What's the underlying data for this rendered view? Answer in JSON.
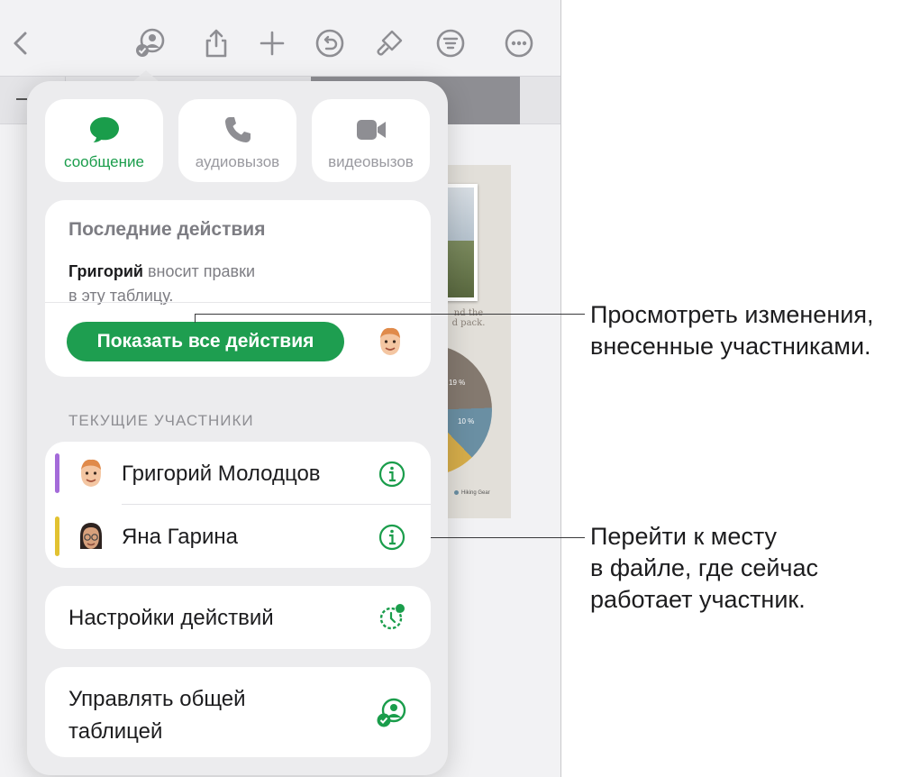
{
  "toolbar": {
    "icons": [
      "back-icon",
      "collaborate-icon",
      "share-icon",
      "add-icon",
      "undo-icon",
      "format-brush-icon",
      "filter-icon",
      "more-icon"
    ]
  },
  "background_sheet": {
    "caption": "nd the\nd pack.",
    "pie_labels": [
      "19 %",
      "10 %"
    ],
    "legend_item": "Hiking Gear"
  },
  "popover": {
    "comm_buttons": [
      {
        "label": "сообщение",
        "icon": "message-icon",
        "active": true
      },
      {
        "label": "аудиовызов",
        "icon": "phone-icon",
        "active": false
      },
      {
        "label": "видеовызов",
        "icon": "video-icon",
        "active": false
      }
    ],
    "activity": {
      "heading": "Последние действия",
      "actor": "Григорий",
      "text_line1": " вносит правки",
      "text_line2": "в эту таблицу.",
      "button_label": "Показать все действия"
    },
    "participants_title": "ТЕКУЩИЕ УЧАСТНИКИ",
    "participants": [
      {
        "name": "Григорий Молодцов",
        "color": "#a46bd9"
      },
      {
        "name": "Яна Гарина",
        "color": "#e2c231"
      }
    ],
    "activity_settings": "Настройки действий",
    "manage_line1": "Управлять общей",
    "manage_line2": "таблицей"
  },
  "callouts": {
    "view_changes_1": "Просмотреть изменения,",
    "view_changes_2": "внесенные участниками.",
    "go_to_1": "Перейти к месту",
    "go_to_2": "в файле, где сейчас",
    "go_to_3": "работает участник."
  },
  "colors": {
    "accent_green": "#1e9e50",
    "toolbar_gray": "#8e8e93"
  }
}
